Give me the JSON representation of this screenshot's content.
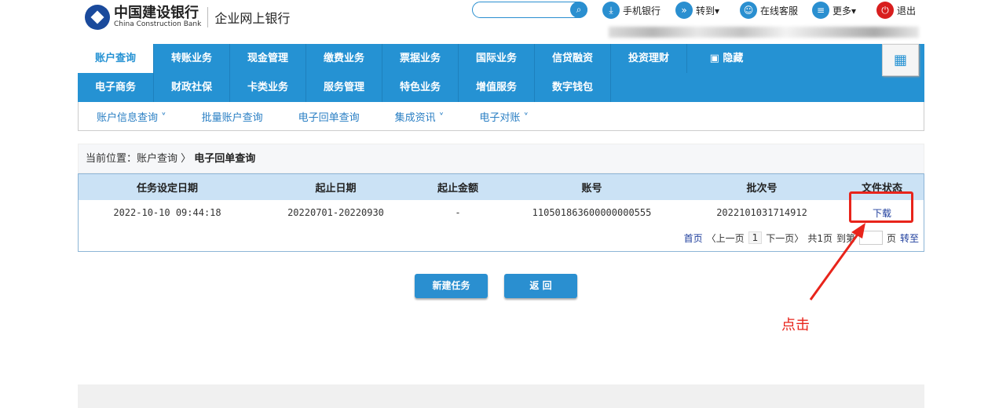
{
  "header": {
    "bank_name_cn": "中国建设银行",
    "bank_name_en": "China Construction Bank",
    "product": "企业网上银行",
    "search": {
      "placeholder": "",
      "value": ""
    },
    "tools": [
      {
        "label": "手机银行",
        "icon": "download-icon"
      },
      {
        "label": "转到▾",
        "icon": "forward-icon"
      },
      {
        "label": "在线客服",
        "icon": "user-icon"
      },
      {
        "label": "更多▾",
        "icon": "list-icon"
      },
      {
        "label": "退出",
        "icon": "power-icon"
      }
    ]
  },
  "nav": {
    "row1": [
      "账户查询",
      "转账业务",
      "现金管理",
      "缴费业务",
      "票据业务",
      "国际业务",
      "信贷融资",
      "投资理财"
    ],
    "hide": "隐藏",
    "row2": [
      "电子商务",
      "财政社保",
      "卡类业务",
      "服务管理",
      "特色业务",
      "增值服务",
      "数字钱包"
    ]
  },
  "subnav": [
    "账户信息查询 ˅",
    "批量账户查询",
    "电子回单查询",
    "集成资讯 ˅",
    "电子对账 ˅"
  ],
  "breadcrumb": {
    "prefix": "当前位置：账户查询 〉",
    "current": "电子回单查询"
  },
  "table": {
    "headers": [
      "任务设定日期",
      "起止日期",
      "起止金额",
      "账号",
      "批次号",
      "文件状态"
    ],
    "rows": [
      [
        "2022-10-10 09:44:18",
        "20220701-20220930",
        "-",
        "110501863600000000555",
        "2022101031714912",
        "下载"
      ]
    ]
  },
  "pager": {
    "first": "首页",
    "prev": "〈上一页",
    "page": "1",
    "next": "下一页〉",
    "total": "共1页",
    "goto_prefix": "到第",
    "goto_suffix": "页",
    "go": "转至"
  },
  "buttons": {
    "new_task": "新建任务",
    "back": "返 回"
  },
  "annotation": {
    "text": "点击",
    "color": "#e8241b"
  },
  "colors": {
    "brand": "#2592d3",
    "link": "#1d3d9c"
  }
}
